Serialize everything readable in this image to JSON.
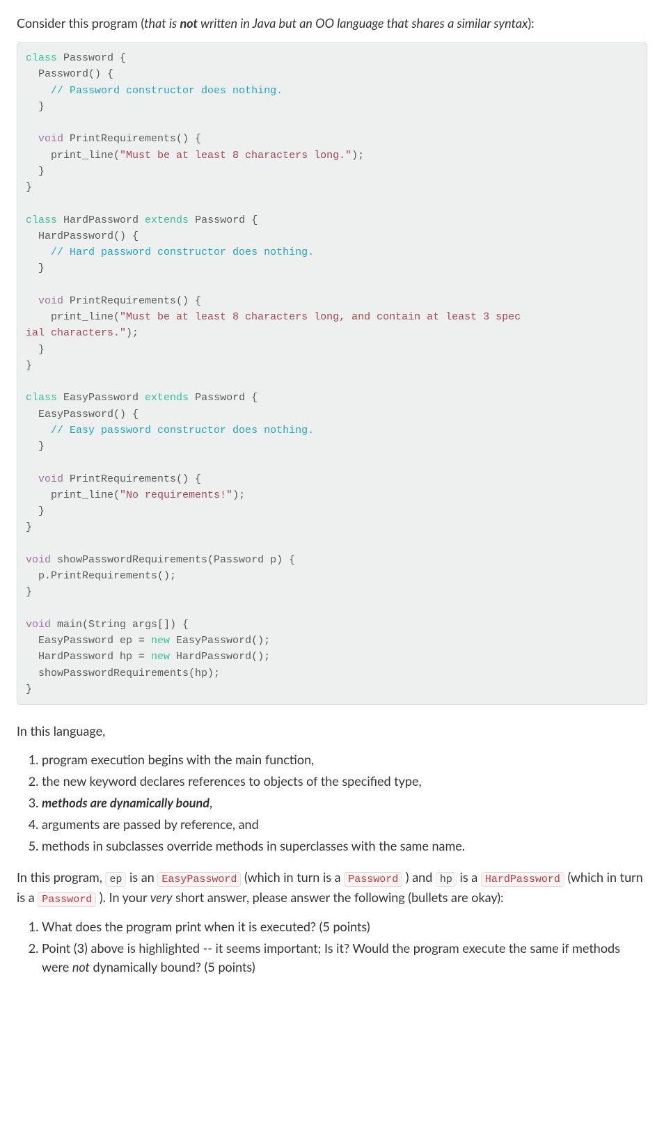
{
  "intro": {
    "pre": "Consider this program (",
    "italic_seg": "that is ",
    "bold_in_italic": "not",
    "italic_rest": " written in Java but an OO language that shares a similar syntax",
    "post": "):"
  },
  "code": {
    "t01a": "class",
    "t01b": " Password {",
    "t02": "  Password() {",
    "t03a": "    ",
    "t03b": "// Password constructor does nothing.",
    "t04": "  }",
    "t05": "",
    "t06a": "  ",
    "t06b": "void",
    "t06c": " PrintRequirements() {",
    "t07a": "    print_line(",
    "t07b": "\"Must be at least 8 characters long.\"",
    "t07c": ");",
    "t08": "  }",
    "t09": "}",
    "t10": "",
    "t11a": "class",
    "t11b": " HardPassword ",
    "t11c": "extends",
    "t11d": " Password {",
    "t12": "  HardPassword() {",
    "t13a": "    ",
    "t13b": "// Hard password constructor does nothing.",
    "t14": "  }",
    "t15": "",
    "t16a": "  ",
    "t16b": "void",
    "t16c": " PrintRequirements() {",
    "t17a": "    print_line(",
    "t17b": "\"Must be at least 8 characters long, and contain at least 3 spec",
    "t18a": "ial characters.\"",
    "t18b": ");",
    "t19": "  }",
    "t20": "}",
    "t21": "",
    "t22a": "class",
    "t22b": " EasyPassword ",
    "t22c": "extends",
    "t22d": " Password {",
    "t23": "  EasyPassword() {",
    "t24a": "    ",
    "t24b": "// Easy password constructor does nothing.",
    "t25": "  }",
    "t26": "",
    "t27a": "  ",
    "t27b": "void",
    "t27c": " PrintRequirements() {",
    "t28a": "    print_line(",
    "t28b": "\"No requirements!\"",
    "t28c": ");",
    "t29": "  }",
    "t30": "}",
    "t31": "",
    "t32a": "void",
    "t32b": " showPasswordRequirements(Password p) {",
    "t33": "  p.PrintRequirements();",
    "t34": "}",
    "t35": "",
    "t36a": "void",
    "t36b": " main(String args[]) {",
    "t37a": "  EasyPassword ep = ",
    "t37b": "new",
    "t37c": " EasyPassword();",
    "t38a": "  HardPassword hp = ",
    "t38b": "new",
    "t38c": " HardPassword();",
    "t39": "  showPasswordRequirements(hp);",
    "t40": "}"
  },
  "mid": "In this language,",
  "rules": {
    "r1": "program execution begins with the main function,",
    "r2": "the new keyword declares references to objects of the specified type,",
    "r3": "methods are dynamically bound",
    "r3_comma": ",",
    "r4": "arguments are passed by reference, and",
    "r5": "methods in subclasses override methods in superclasses with the same name."
  },
  "para2": {
    "a": "In this program, ",
    "ep": "ep",
    "b": " is an ",
    "EasyPassword": "EasyPassword",
    "c": " (which in turn is a ",
    "Password": "Password",
    "d": " ) and ",
    "hp": "hp",
    "e": " is a ",
    "HardPassword": "HardPassword",
    "f": " (which in turn is a ",
    "Password2": "Password",
    "g": " ). In your ",
    "very": "very",
    "h": " short answer, please answer the following (bullets are okay):"
  },
  "questions": {
    "q1": "What does the program print when it is executed? (5 points)",
    "q2a": "Point (3) above is highlighted -- it seems important; Is it? Would the program execute the same if methods were ",
    "q2_not": "not",
    "q2b": " dynamically bound? (5 points)"
  }
}
